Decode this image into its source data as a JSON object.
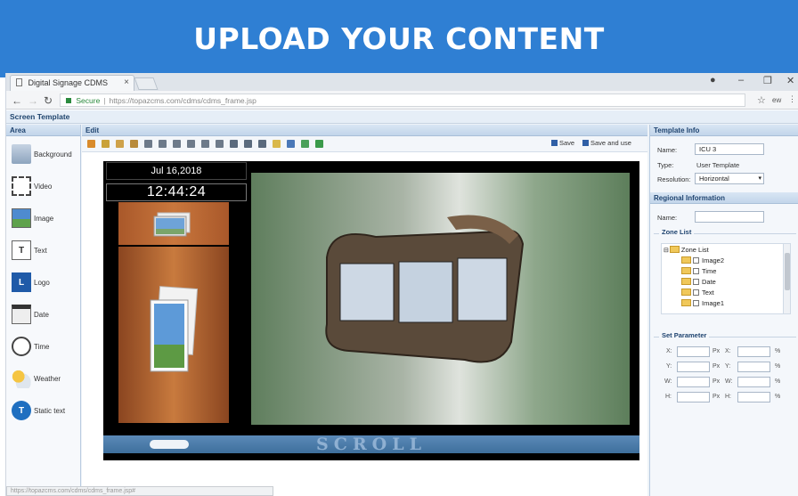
{
  "banner": {
    "title": "UPLOAD YOUR CONTENT"
  },
  "browser": {
    "tab_title": "Digital Signage CDMS",
    "tab_close": "×",
    "secure_label": "Secure",
    "url": "https://topazcms.com/cdms/cdms_frame.jsp",
    "status_url": "https://topazcms.com/cdms/cdms_frame.jsp#"
  },
  "app": {
    "title": "Screen Template",
    "area_header": "Area",
    "edit_header": "Edit",
    "area_items": [
      {
        "label": "Background",
        "icon": "background-icon"
      },
      {
        "label": "Video",
        "icon": "video-icon"
      },
      {
        "label": "Image",
        "icon": "image-icon"
      },
      {
        "label": "Text",
        "icon": "text-icon"
      },
      {
        "label": "Logo",
        "icon": "logo-icon"
      },
      {
        "label": "Date",
        "icon": "date-icon"
      },
      {
        "label": "Time",
        "icon": "clock-icon"
      },
      {
        "label": "Weather",
        "icon": "weather-icon"
      },
      {
        "label": "Static text",
        "icon": "static-text-icon"
      }
    ],
    "toolbar": {
      "save_label": "Save",
      "save_and_use_label": "Save and use"
    },
    "canvas": {
      "date_text": "Jul 16,2018",
      "time_text": "12:44:24",
      "scroll_text": "SCROLL"
    }
  },
  "template_info": {
    "header": "Template Info",
    "name_label": "Name:",
    "name_value": "ICU 3",
    "type_label": "Type:",
    "type_value": "User Template",
    "resolution_label": "Resolution:",
    "resolution_value": "Horizontal"
  },
  "regional_info": {
    "header": "Regional Information",
    "name_label": "Name:",
    "name_value": "",
    "zone_list_legend": "Zone List",
    "zone_root": "Zone List",
    "zones": [
      "Image2",
      "Time",
      "Date",
      "Text",
      "Image1"
    ],
    "set_param_legend": "Set Parameter",
    "params": [
      "X:",
      "Y:",
      "W:",
      "H:"
    ],
    "px_label": "Px",
    "pct_label": "%"
  },
  "colors": {
    "banner": "#2f7fd3",
    "panel_header": "#1f4470",
    "scroll_zone": "#4a7cab"
  }
}
